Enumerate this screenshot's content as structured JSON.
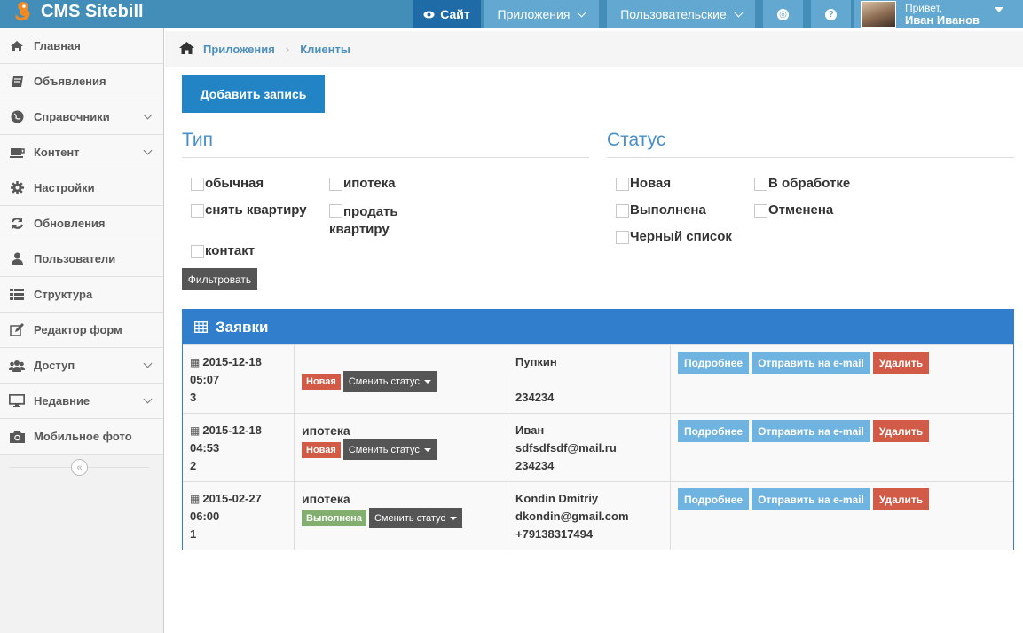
{
  "navbar": {
    "brand": "CMS Sitebill",
    "site_label": "Сайт",
    "apps_label": "Приложения",
    "custom_label": "Пользовательские",
    "user_greeting": "Привет,",
    "user_name": "Иван Иванов"
  },
  "sidebar": {
    "items": [
      {
        "label": "Главная",
        "icon": "home-icon"
      },
      {
        "label": "Объявления",
        "icon": "book-icon"
      },
      {
        "label": "Справочники",
        "icon": "globe-icon",
        "expandable": true
      },
      {
        "label": "Контент",
        "icon": "coffee-icon",
        "expandable": true
      },
      {
        "label": "Настройки",
        "icon": "gear-icon"
      },
      {
        "label": "Обновления",
        "icon": "refresh-icon"
      },
      {
        "label": "Пользователи",
        "icon": "user-icon"
      },
      {
        "label": "Структура",
        "icon": "list-icon"
      },
      {
        "label": "Редактор форм",
        "icon": "edit-icon"
      },
      {
        "label": "Доступ",
        "icon": "group-icon",
        "expandable": true
      },
      {
        "label": "Недавние",
        "icon": "desktop-icon",
        "expandable": true
      },
      {
        "label": "Мобильное фото",
        "icon": "camera-icon"
      }
    ]
  },
  "breadcrumbs": {
    "item1": "Приложения",
    "item2": "Клиенты"
  },
  "add_button": "Добавить запись",
  "type_section": {
    "title": "Тип",
    "options": {
      "ordinary": "обычная",
      "mortgage": "ипотека",
      "rent": "снять квартиру",
      "sell": "продать квартиру",
      "contact": "контакт"
    }
  },
  "status_section": {
    "title": "Статус",
    "options": {
      "new": "Новая",
      "processing": "В обработке",
      "done": "Выполнена",
      "cancelled": "Отменена",
      "blacklist": "Черный список"
    }
  },
  "filter_button": "Фильтровать",
  "table": {
    "title": "Заявки",
    "change_status_label": "Сменить статус",
    "more_label": "Подробнее",
    "email_label": "Отправить на e-mail",
    "delete_label": "Удалить",
    "rows": [
      {
        "date": "2015-12-18",
        "time": "05:07",
        "id": "3",
        "type": "",
        "status": "Новая",
        "name": "Пупкин",
        "email": "",
        "phone": "234234"
      },
      {
        "date": "2015-12-18",
        "time": "04:53",
        "id": "2",
        "type": "ипотека",
        "status": "Новая",
        "name": "Иван",
        "email": "sdfsdfsdf@mail.ru",
        "phone": "234234"
      },
      {
        "date": "2015-02-27",
        "time": "06:00",
        "id": "1",
        "type": "ипотека",
        "status": "Выполнена",
        "name": "Kondin Dmitriy",
        "email": "dkondin@gmail.com",
        "phone": "+79138317494"
      }
    ]
  },
  "colors": {
    "navbar": "#438eb9",
    "primary": "#2283c5",
    "widget": "#307ecc",
    "danger": "#d15b47",
    "success": "#82af6f",
    "info": "#6fb3e0"
  }
}
